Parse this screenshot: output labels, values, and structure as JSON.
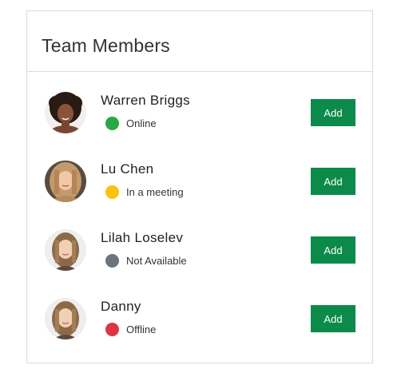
{
  "card": {
    "title": "Team Members"
  },
  "members": [
    {
      "name": "Warren Briggs",
      "status": "Online",
      "status_color": "#28a745",
      "action_label": "Add"
    },
    {
      "name": "Lu Chen",
      "status": "In a meeting",
      "status_color": "#ffc107",
      "action_label": "Add"
    },
    {
      "name": "Lilah Loselev",
      "status": "Not Available",
      "status_color": "#6c757d",
      "action_label": "Add"
    },
    {
      "name": "Danny",
      "status": "Offline",
      "status_color": "#dc3545",
      "action_label": "Add"
    }
  ],
  "colors": {
    "button": "#0b8a4a"
  }
}
